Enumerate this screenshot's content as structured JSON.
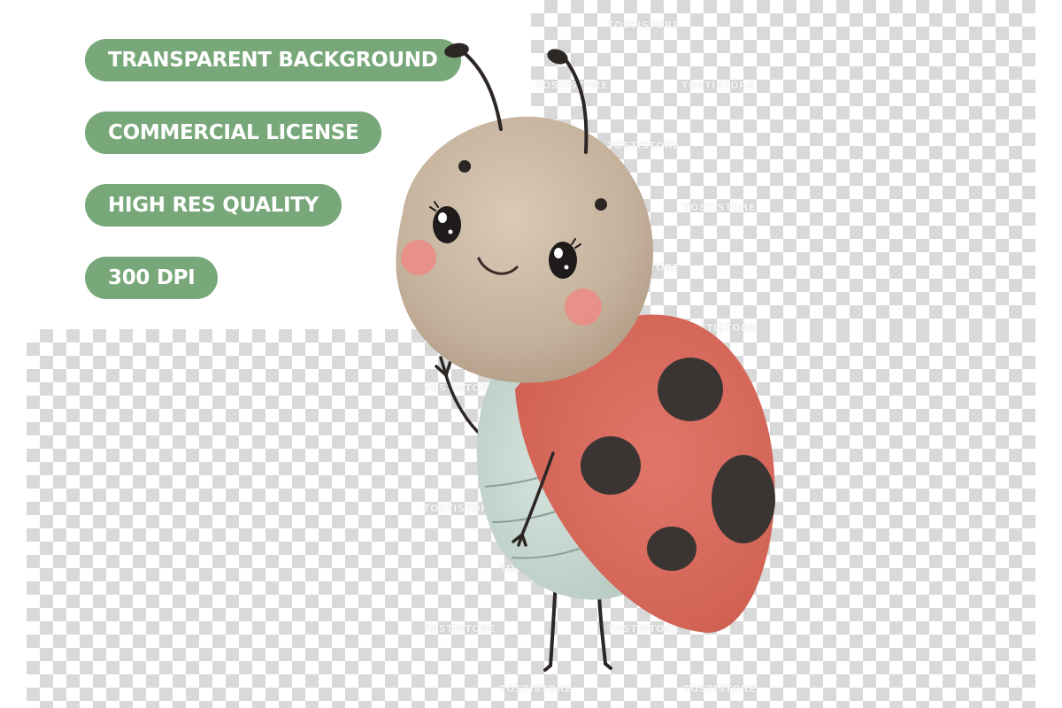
{
  "badges": [
    {
      "label": "TRANSPARENT BACKGROUND"
    },
    {
      "label": "COMMERCIAL LICENSE"
    },
    {
      "label": "HIGH RES QUALITY"
    },
    {
      "label": "300 DPI"
    }
  ],
  "watermark": "TOSTISTORE",
  "colors": {
    "badge": "#78a87a",
    "checker": "#d9d9d9",
    "ladybug_head": "#c9b7a3",
    "ladybug_shell": "#d9695c",
    "ladybug_spots": "#3a3533",
    "ladybug_belly": "#c9d8d2",
    "cheeks": "#ea8d86"
  },
  "illustration": {
    "subject": "ladybug",
    "icon": "ladybug-icon"
  }
}
